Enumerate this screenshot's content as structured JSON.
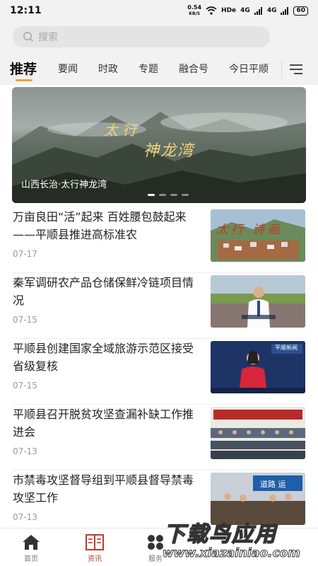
{
  "status_bar": {
    "time": "12:11",
    "net_speed": "0.54",
    "net_unit": "KB/S",
    "hd": "HDe",
    "sig1": "4G",
    "sig2": "4G",
    "battery": "60"
  },
  "search": {
    "placeholder": "搜索"
  },
  "tabs": [
    {
      "label": "推荐",
      "active": true
    },
    {
      "label": "要闻"
    },
    {
      "label": "时政"
    },
    {
      "label": "专题"
    },
    {
      "label": "融合号"
    },
    {
      "label": "今日平顺"
    }
  ],
  "banner": {
    "title_line1": "太行",
    "title_line2": "神龙湾",
    "caption": "山西长治·太行神龙湾",
    "slide_count": 4,
    "active_slide": 1
  },
  "news": [
    {
      "title": "万亩良田“活”起来 百姓腰包鼓起来 ——平顺县推进高标准农",
      "date": "07-17",
      "thumb": "landscape-village",
      "thumb_text": "太行 诗画"
    },
    {
      "title": "秦军调研农产品仓储保鲜冷链项目情况",
      "date": "07-15",
      "thumb": "man-field"
    },
    {
      "title": "平顺县创建国家全域旅游示范区接受省级复核",
      "date": "07-15",
      "thumb": "news-anchor",
      "thumb_text": "平顺新闻"
    },
    {
      "title": "平顺县召开脱贫攻坚查漏补缺工作推进会",
      "date": "07-13",
      "thumb": "meeting-hall"
    },
    {
      "title": "市禁毒攻坚督导组到平顺县督导禁毒攻坚工作",
      "date": "07-13",
      "thumb": "meeting-room",
      "thumb_text": "道路 运"
    }
  ],
  "bottom_nav": [
    {
      "label": "首页",
      "icon": "home-icon"
    },
    {
      "label": "资讯",
      "icon": "book-icon",
      "active": true
    },
    {
      "label": "服务",
      "icon": "apps-icon"
    }
  ],
  "watermark": {
    "big": "下载鸟应用",
    "small": "www.xiazainiao.com"
  },
  "colors": {
    "accent": "#e4a33a",
    "active_nav": "#c0392b",
    "header_bg": "#f2f2f2"
  }
}
